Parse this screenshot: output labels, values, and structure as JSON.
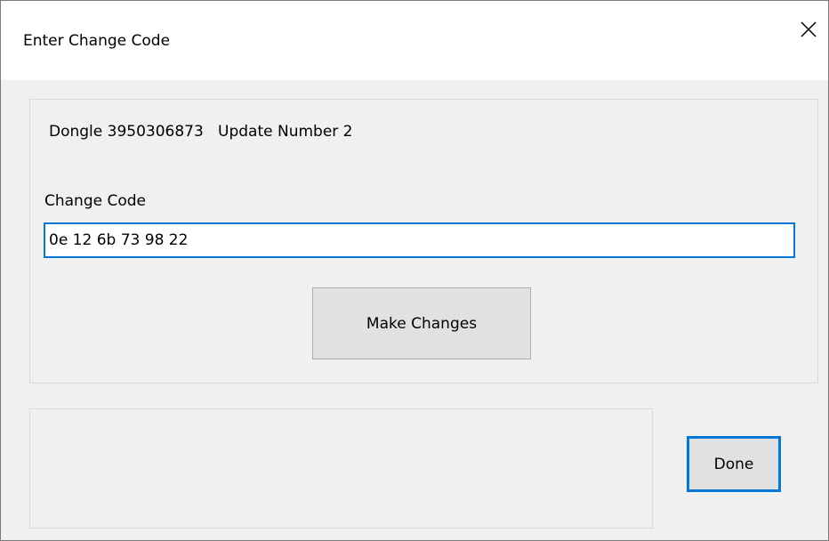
{
  "window": {
    "title": "Enter Change Code",
    "close_icon": "close-icon"
  },
  "info": {
    "text": "Dongle 3950306873   Update Number 2"
  },
  "change_code": {
    "label": "Change Code",
    "value": "0e 12 6b 73 98 22"
  },
  "buttons": {
    "make_changes": "Make Changes",
    "done": "Done"
  },
  "colors": {
    "accent": "#0078d7",
    "dialog_background": "#f0f0f0",
    "button_face": "#e1e1e1"
  }
}
